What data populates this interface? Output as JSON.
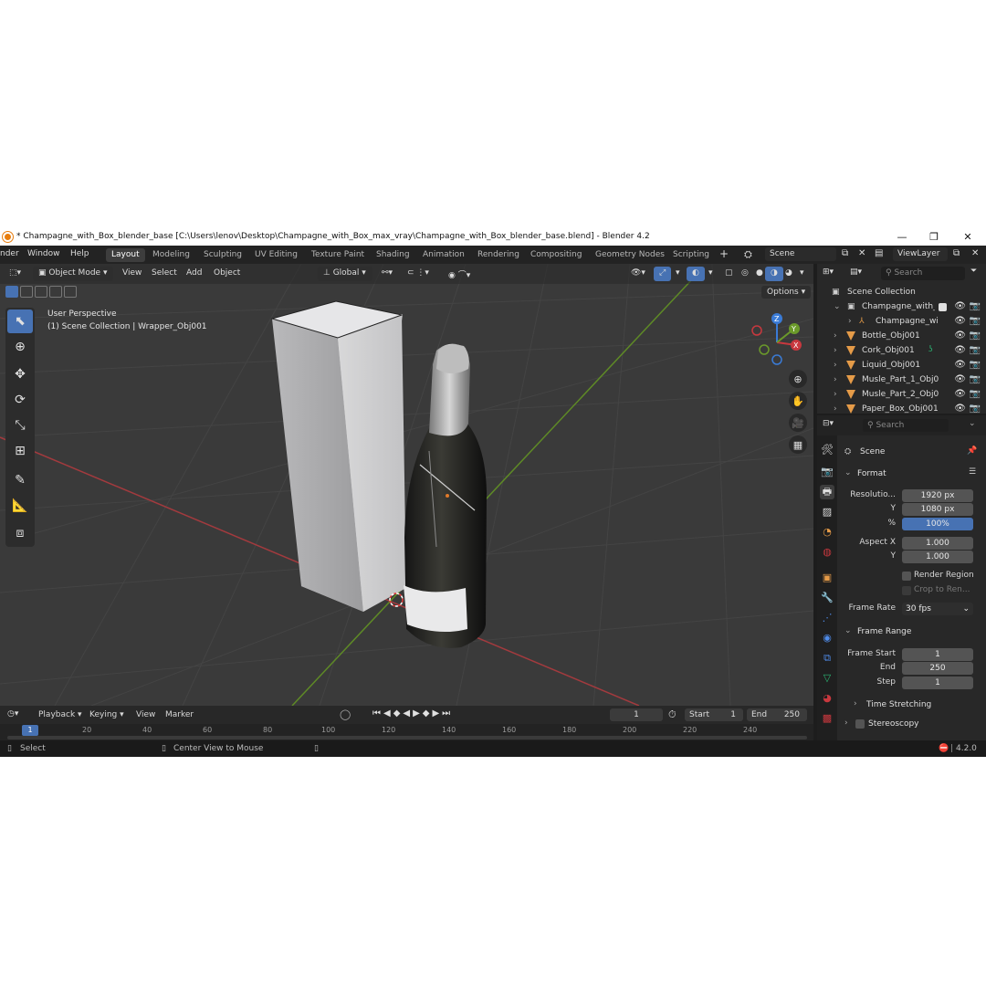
{
  "window": {
    "title": "* Champagne_with_Box_blender_base [C:\\Users\\lenov\\Desktop\\Champagne_with_Box_max_vray\\Champagne_with_Box_blender_base.blend] - Blender 4.2",
    "minimize": "—",
    "maximize": "❐",
    "close": "✕"
  },
  "menu": [
    "nder",
    "Window",
    "Help"
  ],
  "workspaces": [
    "Layout",
    "Modeling",
    "Sculpting",
    "UV Editing",
    "Texture Paint",
    "Shading",
    "Animation",
    "Rendering",
    "Compositing",
    "Geometry Nodes",
    "Scripting"
  ],
  "scene_field": "Scene",
  "view_layer_field": "ViewLayer",
  "viewport": {
    "mode": "Object Mode",
    "menus": [
      "View",
      "Select",
      "Add",
      "Object"
    ],
    "orientation": "Global",
    "options": "Options",
    "overlay_line1": "User Perspective",
    "overlay_line2": "(1) Scene Collection | Wrapper_Obj001",
    "gizmo": {
      "z": "Z",
      "y": "Y",
      "x": "X"
    }
  },
  "outliner": {
    "search_placeholder": "Search",
    "root": "Scene Collection",
    "items": [
      "Champagne_with_I",
      "Champagne_wi",
      "Bottle_Obj001",
      "Cork_Obj001",
      "Liquid_Obj001",
      "Musle_Part_1_Obj0",
      "Musle_Part_2_Obj0",
      "Paper_Box_Obj001"
    ]
  },
  "properties": {
    "search_placeholder": "Search",
    "context": "Scene",
    "format_panel": "Format",
    "resolution_x_label": "Resolutio...",
    "resolution_x": "1920 px",
    "resolution_y_label": "Y",
    "resolution_y": "1080 px",
    "percent_label": "%",
    "percent": "100%",
    "aspect_x_label": "Aspect X",
    "aspect_x": "1.000",
    "aspect_y_label": "Y",
    "aspect_y": "1.000",
    "render_region": "Render Region",
    "crop_to_render": "Crop to Ren...",
    "frame_rate_label": "Frame Rate",
    "frame_rate": "30 fps",
    "frame_range_panel": "Frame Range",
    "frame_start_label": "Frame Start",
    "frame_start": "1",
    "end_label": "End",
    "end": "250",
    "step_label": "Step",
    "step": "1",
    "time_stretching": "Time Stretching",
    "stereoscopy": "Stereoscopy"
  },
  "timeline": {
    "menus": [
      "Playback",
      "Keying",
      "View",
      "Marker"
    ],
    "current_frame": "1",
    "start_label": "Start",
    "start": "1",
    "end_label": "End",
    "end": "250",
    "ruler": [
      "1",
      "20",
      "40",
      "60",
      "80",
      "100",
      "120",
      "140",
      "160",
      "180",
      "200",
      "220",
      "240"
    ]
  },
  "status": {
    "select": "Select",
    "center_view": "Center View to Mouse",
    "version": "4.2.0"
  },
  "colors": {
    "accent": "#4772b3",
    "x_axis": "#c8383e",
    "y_axis": "#6b9a2a",
    "z_axis": "#3a7bd6",
    "object_icon": "#e59b48"
  }
}
